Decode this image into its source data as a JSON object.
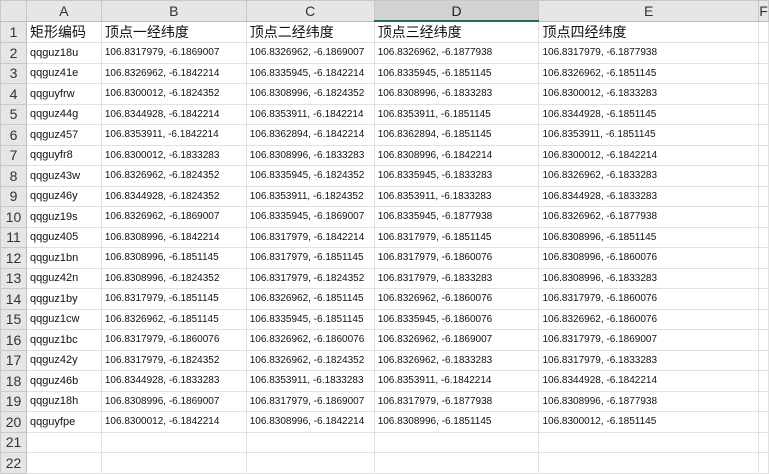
{
  "columns": [
    "A",
    "B",
    "C",
    "D",
    "E",
    "F"
  ],
  "selected_column": "D",
  "row_numbers": [
    "1",
    "2",
    "3",
    "4",
    "5",
    "6",
    "7",
    "8",
    "9",
    "10",
    "11",
    "12",
    "13",
    "14",
    "15",
    "16",
    "17",
    "18",
    "19",
    "20",
    "21",
    "22"
  ],
  "header_row": [
    "矩形编码",
    "顶点一经纬度",
    "顶点二经纬度",
    "顶点三经纬度",
    "顶点四经纬度",
    ""
  ],
  "rows": [
    [
      "qqguz18u",
      "106.8317979, -6.1869007",
      "106.8326962, -6.1869007",
      "106.8326962, -6.1877938",
      "106.8317979, -6.1877938",
      ""
    ],
    [
      "qqguz41e",
      "106.8326962, -6.1842214",
      "106.8335945, -6.1842214",
      "106.8335945, -6.1851145",
      "106.8326962, -6.1851145",
      ""
    ],
    [
      "qqguyfrw",
      "106.8300012, -6.1824352",
      "106.8308996, -6.1824352",
      "106.8308996, -6.1833283",
      "106.8300012, -6.1833283",
      ""
    ],
    [
      "qqguz44g",
      "106.8344928, -6.1842214",
      "106.8353911, -6.1842214",
      "106.8353911, -6.1851145",
      "106.8344928, -6.1851145",
      ""
    ],
    [
      "qqguz457",
      "106.8353911, -6.1842214",
      "106.8362894, -6.1842214",
      "106.8362894, -6.1851145",
      "106.8353911, -6.1851145",
      ""
    ],
    [
      "qqguyfr8",
      "106.8300012, -6.1833283",
      "106.8308996, -6.1833283",
      "106.8308996, -6.1842214",
      "106.8300012, -6.1842214",
      ""
    ],
    [
      "qqguz43w",
      "106.8326962, -6.1824352",
      "106.8335945, -6.1824352",
      "106.8335945, -6.1833283",
      "106.8326962, -6.1833283",
      ""
    ],
    [
      "qqguz46y",
      "106.8344928, -6.1824352",
      "106.8353911, -6.1824352",
      "106.8353911, -6.1833283",
      "106.8344928, -6.1833283",
      ""
    ],
    [
      "qqguz19s",
      "106.8326962, -6.1869007",
      "106.8335945, -6.1869007",
      "106.8335945, -6.1877938",
      "106.8326962, -6.1877938",
      ""
    ],
    [
      "qqguz405",
      "106.8308996, -6.1842214",
      "106.8317979, -6.1842214",
      "106.8317979, -6.1851145",
      "106.8308996, -6.1851145",
      ""
    ],
    [
      "qqguz1bn",
      "106.8308996, -6.1851145",
      "106.8317979, -6.1851145",
      "106.8317979, -6.1860076",
      "106.8308996, -6.1860076",
      ""
    ],
    [
      "qqguz42n",
      "106.8308996, -6.1824352",
      "106.8317979, -6.1824352",
      "106.8317979, -6.1833283",
      "106.8308996, -6.1833283",
      ""
    ],
    [
      "qqguz1by",
      "106.8317979, -6.1851145",
      "106.8326962, -6.1851145",
      "106.8326962, -6.1860076",
      "106.8317979, -6.1860076",
      ""
    ],
    [
      "qqguz1cw",
      "106.8326962, -6.1851145",
      "106.8335945, -6.1851145",
      "106.8335945, -6.1860076",
      "106.8326962, -6.1860076",
      ""
    ],
    [
      "qqguz1bc",
      "106.8317979, -6.1860076",
      "106.8326962, -6.1860076",
      "106.8326962, -6.1869007",
      "106.8317979, -6.1869007",
      ""
    ],
    [
      "qqguz42y",
      "106.8317979, -6.1824352",
      "106.8326962, -6.1824352",
      "106.8326962, -6.1833283",
      "106.8317979, -6.1833283",
      ""
    ],
    [
      "qqguz46b",
      "106.8344928, -6.1833283",
      "106.8353911, -6.1833283",
      "106.8353911, -6.1842214",
      "106.8344928, -6.1842214",
      ""
    ],
    [
      "qqguz18h",
      "106.8308996, -6.1869007",
      "106.8317979, -6.1869007",
      "106.8317979, -6.1877938",
      "106.8308996, -6.1877938",
      ""
    ],
    [
      "qqguyfpe",
      "106.8300012, -6.1842214",
      "106.8308996, -6.1842214",
      "106.8308996, -6.1851145",
      "106.8300012, -6.1851145",
      ""
    ],
    [
      "",
      "",
      "",
      "",
      "",
      ""
    ],
    [
      "",
      "",
      "",
      "",
      "",
      ""
    ]
  ]
}
